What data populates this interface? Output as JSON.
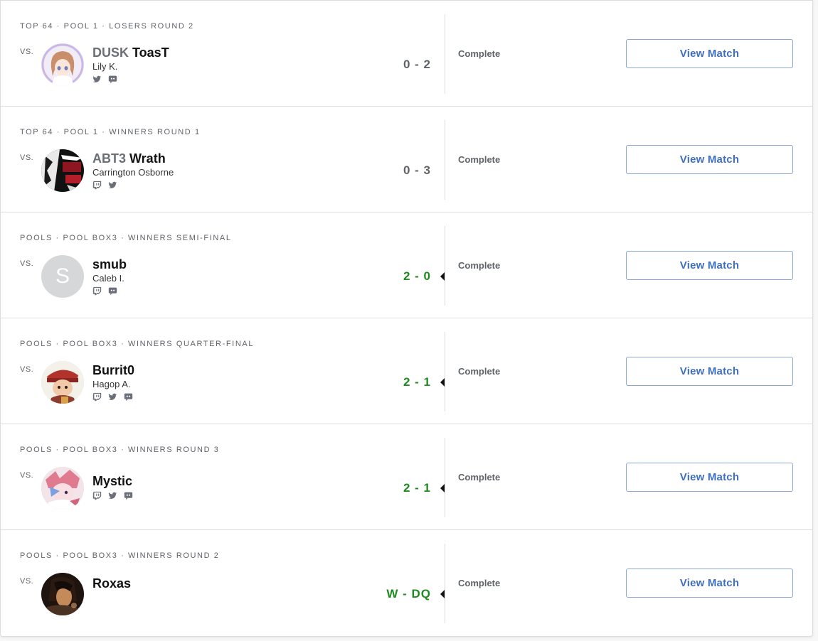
{
  "matches": [
    {
      "round": "TOP 64 · POOL 1 · LOSERS ROUND 2",
      "vs": "VS.",
      "prefix": "DUSK",
      "tag": "ToasT",
      "name": "Lily K.",
      "score": "0 - 2",
      "status": "Complete",
      "button": "View Match",
      "socials": [
        "twitter-icon",
        "discord-icon"
      ],
      "won": false,
      "avatar": "anime-girl-avatar"
    },
    {
      "round": "TOP 64 · POOL 1 · WINNERS ROUND 1",
      "vs": "VS.",
      "prefix": "ABT3",
      "tag": "Wrath",
      "name": "Carrington Osborne",
      "score": "0 - 3",
      "status": "Complete",
      "button": "View Match",
      "socials": [
        "twitch-icon",
        "twitter-icon"
      ],
      "won": false,
      "avatar": "red-black-graphic-avatar"
    },
    {
      "round": "POOLS · POOL BOX3 · WINNERS SEMI-FINAL",
      "vs": "VS.",
      "prefix": "",
      "tag": "smub",
      "name": "Caleb I.",
      "score": "2 - 0",
      "status": "Complete",
      "button": "View Match",
      "socials": [
        "twitch-icon",
        "discord-icon"
      ],
      "won": true,
      "avatar": "initial-avatar",
      "initial": "S"
    },
    {
      "round": "POOLS · POOL BOX3 · WINNERS QUARTER-FINAL",
      "vs": "VS.",
      "prefix": "",
      "tag": "Burrit0",
      "name": "Hagop A.",
      "score": "2 - 1",
      "status": "Complete",
      "button": "View Match",
      "socials": [
        "twitch-icon",
        "twitter-icon",
        "discord-icon"
      ],
      "won": true,
      "avatar": "red-cap-character-avatar"
    },
    {
      "round": "POOLS · POOL BOX3 · WINNERS ROUND 3",
      "vs": "VS.",
      "prefix": "",
      "tag": "Mystic",
      "name": "",
      "score": "2 - 1",
      "status": "Complete",
      "button": "View Match",
      "socials": [
        "twitch-icon",
        "twitter-icon",
        "discord-icon"
      ],
      "won": true,
      "avatar": "pink-blue-character-avatar"
    },
    {
      "round": "POOLS · POOL BOX3 · WINNERS ROUND 2",
      "vs": "VS.",
      "prefix": "",
      "tag": "Roxas",
      "name": "",
      "score": "W - DQ",
      "status": "Complete",
      "button": "View Match",
      "socials": [],
      "won": true,
      "avatar": "dark-portrait-avatar"
    }
  ],
  "colors": {
    "win": "#1f8a1f",
    "loss": "#5f6368",
    "button_text": "#3f6fc2",
    "button_border": "#8aa6d9"
  }
}
